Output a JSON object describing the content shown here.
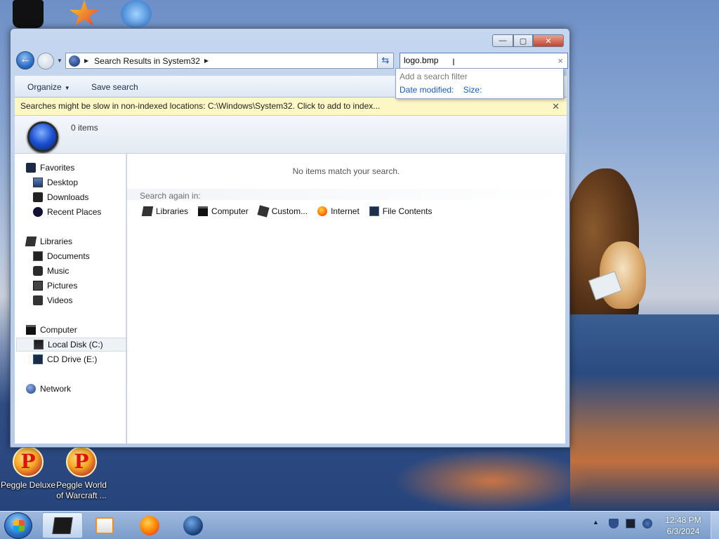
{
  "desktop": {
    "icons": [
      {
        "label": "Peggle Deluxe"
      },
      {
        "label": "Peggle World of Warcraft ..."
      }
    ],
    "peggle_glyph": "P"
  },
  "window": {
    "caption": {
      "minimize": "—",
      "maximize": "▢",
      "close": "✕"
    },
    "address": {
      "separator": "▶",
      "location": "Search Results in System32",
      "trail": "▶",
      "dropdown": "▼"
    },
    "refresh": "⇆",
    "search": {
      "value": "logo.bmp",
      "clear": "×",
      "caret": "I"
    },
    "filter_popup": {
      "hint": "Add a search filter",
      "date_modified": "Date modified:",
      "size": "Size:"
    },
    "toolbar": {
      "organize": "Organize",
      "organize_drop": "▼",
      "save_search": "Save search"
    },
    "infobar": {
      "message": "Searches might be slow in non-indexed locations: C:\\Windows\\System32. Click to add to index...",
      "close": "✕"
    },
    "details": {
      "count": "0 items"
    },
    "nav": {
      "favorites": "Favorites",
      "desktop": "Desktop",
      "downloads": "Downloads",
      "recent_places": "Recent Places",
      "libraries": "Libraries",
      "documents": "Documents",
      "music": "Music",
      "pictures": "Pictures",
      "videos": "Videos",
      "computer": "Computer",
      "local_disk": "Local Disk (C:)",
      "cd_drive": "CD Drive (E:)",
      "network": "Network"
    },
    "content": {
      "no_items": "No items match your search.",
      "search_again": "Search again in:",
      "locations": {
        "libraries": "Libraries",
        "computer": "Computer",
        "custom": "Custom...",
        "internet": "Internet",
        "file_contents": "File Contents"
      }
    }
  },
  "taskbar": {
    "tray_up": "▲",
    "time": "12:48 PM",
    "date": "6/3/2024"
  }
}
